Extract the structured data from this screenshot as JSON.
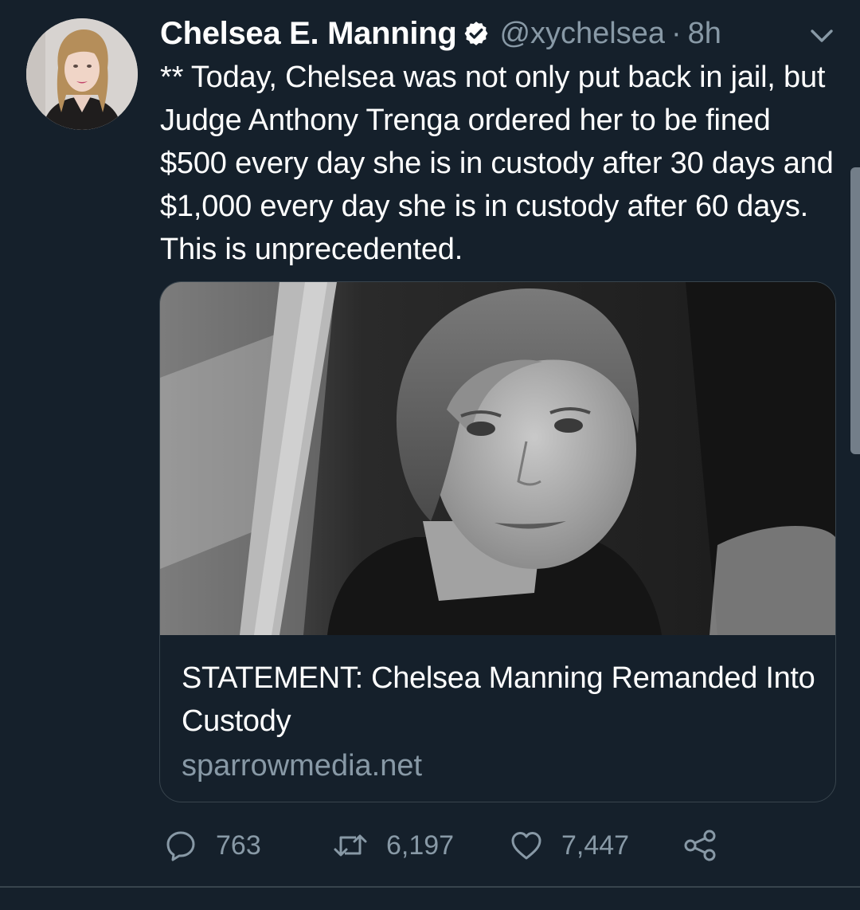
{
  "tweet": {
    "author": {
      "display_name": "Chelsea E. Manning",
      "handle": "@xychelsea",
      "separator": "·",
      "time": "8h",
      "verified": true
    },
    "text": "** Today, Chelsea was not only put back in jail, but Judge Anthony Trenga ordered her to be fined $500 every day she is in custody after 30 days and $1,000 every day she is in custody after 60 days. This is unprecedented.",
    "card": {
      "title": "STATEMENT: Chelsea Manning Remanded Into Custody",
      "domain": "sparrowmedia.net"
    },
    "actions": {
      "replies": "763",
      "retweets": "6,197",
      "likes": "7,447"
    }
  },
  "icons": {
    "verified": "verified-badge-icon",
    "caret": "chevron-down-icon",
    "reply": "reply-bubble-icon",
    "retweet": "retweet-arrows-icon",
    "like": "heart-icon",
    "share": "share-nodes-icon"
  },
  "colors": {
    "background": "#15202b",
    "text_primary": "#ffffff",
    "text_secondary": "#8899a6",
    "border": "#38444d"
  }
}
